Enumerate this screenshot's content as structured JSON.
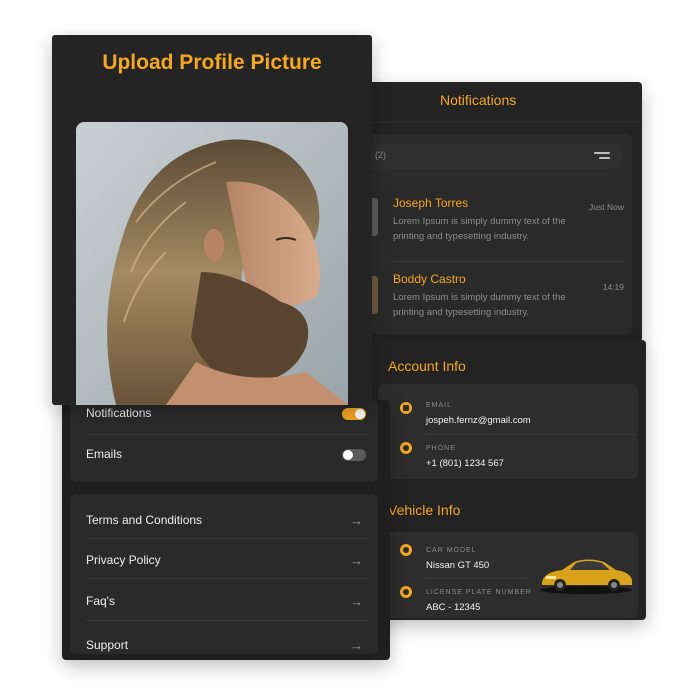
{
  "notifications": {
    "title": "Notifications",
    "search_text": "y (2)",
    "items": [
      {
        "name": "Joseph Torres",
        "message": "Lorem Ipsum is simply dummy text of the printing and typesetting industry.",
        "time": "Just Now"
      },
      {
        "name": "Boddy Castro",
        "message": "Lorem Ipsum is simply dummy text of the printing and typesetting industry.",
        "time": "14:19"
      }
    ]
  },
  "account": {
    "account_title": "Account Info",
    "email_label": "EMAIL",
    "email_value": "jospeh.fernz@gmail.com",
    "phone_label": "PHONE",
    "phone_value": "+1 (801) 1234 567",
    "vehicle_title": "Vehicle Info",
    "car_model_label": "CAR MODEL",
    "car_model_value": "Nissan GT 450",
    "plate_label": "LICENSE PLATE NUMBER",
    "plate_value": "ABC - 12345"
  },
  "settings": {
    "toggles": [
      {
        "label": "Notifications",
        "on": true
      },
      {
        "label": "Emails",
        "on": false
      }
    ],
    "links": [
      "Terms and Conditions",
      "Privacy Policy",
      "Faq's",
      "Support"
    ]
  },
  "upload": {
    "title": "Upload Profile Picture"
  },
  "colors": {
    "accent": "#f5a623",
    "background": "#232323",
    "panel": "#2c2c2c"
  }
}
